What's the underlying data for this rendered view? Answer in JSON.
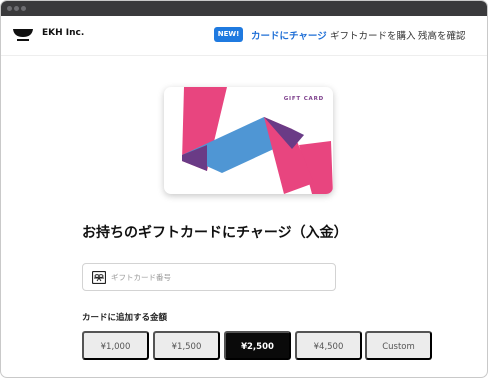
{
  "header": {
    "brand": "EKH Inc.",
    "badge": "NEW!",
    "nav": {
      "charge": "カードにチャージ",
      "buy": "ギフトカードを購入",
      "balance": "残高を確認"
    }
  },
  "card": {
    "label": "GIFT CARD"
  },
  "main": {
    "title": "お持ちのギフトカードにチャージ（入金）",
    "code_input": {
      "placeholder": "ギフトカード番号",
      "value": ""
    },
    "amount_label": "カードに追加する金額",
    "amounts": [
      "¥1,000",
      "¥1,500",
      "¥2,500",
      "¥4,500",
      "Custom"
    ],
    "selected_amount": "¥2,500"
  },
  "colors": {
    "accent": "#1f7ae0",
    "titlebar": "#3a3a3c",
    "selected_button": "#0a0a0a",
    "card_pink": "#e8457f",
    "card_blue": "#4f96d4",
    "card_purple": "#6a3b86"
  },
  "icons": {
    "logo": "bowl-logo-icon",
    "field": "gift-card-icon"
  }
}
